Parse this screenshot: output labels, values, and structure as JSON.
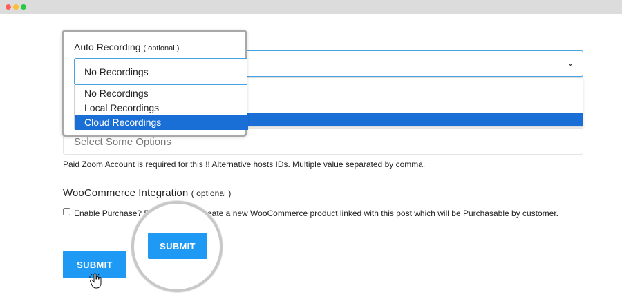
{
  "auto_recording": {
    "label": "Auto Recording",
    "optional": "( optional )",
    "selected": "No Recordings",
    "options": [
      "No Recordings",
      "Local Recordings",
      "Cloud Recordings"
    ],
    "highlighted_option": "Cloud Recordings"
  },
  "alternative_hosts": {
    "placeholder": "Select Some Options",
    "help_text": "Paid Zoom Account is required for this !! Alternative hosts IDs. Multiple value separated by comma."
  },
  "woocommerce": {
    "title": "WooCommerce Integration",
    "optional": "( optional )",
    "checkbox_label": "Enable Purchase? E",
    "description": "reate a new WooCommerce product linked with this post which will be Purchasable by customer.",
    "checked": false
  },
  "submit_label": "SUBMIT",
  "icons": {
    "dropdown": "chevron-down-icon",
    "cursor": "hand-pointer-icon"
  },
  "colors": {
    "accent": "#1e9af5",
    "highlight": "#1a6fd6",
    "focus_border": "#4aa3df"
  }
}
